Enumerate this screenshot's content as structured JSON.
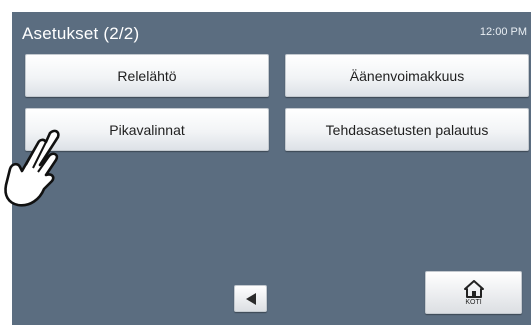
{
  "header": {
    "title": "Asetukset (2/2)",
    "time": "12:00 PM"
  },
  "menu": [
    {
      "label": "Relelähtö"
    },
    {
      "label": "Äänenvoimakkuus"
    },
    {
      "label": "Pikavalinnat"
    },
    {
      "label": "Tehdasasetusten palautus"
    }
  ],
  "nav": {
    "back_icon": "triangle-left-icon",
    "home_icon": "house-icon",
    "home_label": "KOTI"
  },
  "overlay": {
    "pointer_icon": "hand-pointer-icon"
  },
  "colors": {
    "screen_bg": "#5b6d80",
    "button_bg": "#f2f4f6",
    "text": "#1f1f1f"
  }
}
